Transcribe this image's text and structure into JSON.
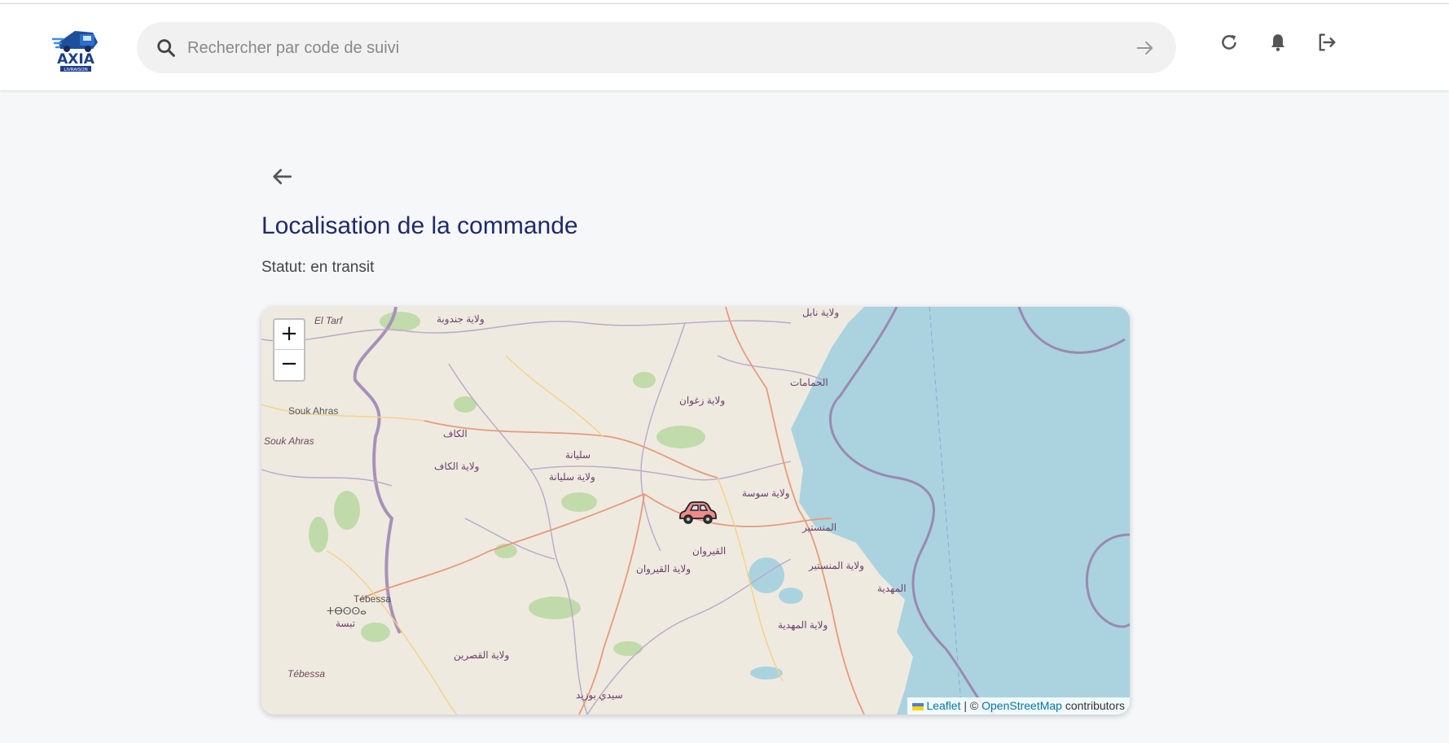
{
  "header": {
    "logo_alt": "AXIA LIVRAISON",
    "search": {
      "placeholder": "Rechercher par code de suivi",
      "value": ""
    },
    "actions": [
      {
        "name": "refresh-icon"
      },
      {
        "name": "bell-icon"
      },
      {
        "name": "logout-icon"
      }
    ]
  },
  "page": {
    "title": "Localisation de la commande",
    "status_label": "Statut:",
    "status_value": "en transit"
  },
  "map": {
    "zoom_in": "+",
    "zoom_out": "−",
    "marker": "car-icon",
    "attribution": {
      "leaflet": "Leaflet",
      "separator": "| ©",
      "osm": "OpenStreetMap",
      "suffix": "contributors"
    },
    "labels": {
      "el_tarf": "El Tarf",
      "jendouba": "ولاية جندوبة",
      "nabeul": "ولاية نابل",
      "souk_ahras_city": "Souk Ahras",
      "souk_ahras_region": "Souk Ahras",
      "kef_city": "الكاف",
      "kef_gov": "ولاية الكاف",
      "hammamet": "الحمامات",
      "zaghouan": "ولاية زغوان",
      "siliana_city": "سليانة",
      "siliana_gov": "ولاية سليانة",
      "sousse_gov": "ولاية سوسة",
      "monastir_city": "المنستير",
      "kairouan_city": "القيروان",
      "kairouan_gov": "ولاية القيروان",
      "monastir_gov": "ولاية المنستير",
      "mahdia_city": "المهدية",
      "tebessa_city": "Tébessa",
      "tebessa_tif": "ⵜⴱⵙⵙⴰ",
      "tebessa_ar": "تبسة",
      "kasserine_gov": "ولاية القصرين",
      "mahdia_gov": "ولاية المهدية",
      "tebessa_region": "Tébessa",
      "sidi_bouzid": "سيدي بوزيد"
    }
  },
  "colors": {
    "title": "#1f2a6b",
    "sea": "#aad3df",
    "land": "#efeae0",
    "link": "#0078a8"
  }
}
